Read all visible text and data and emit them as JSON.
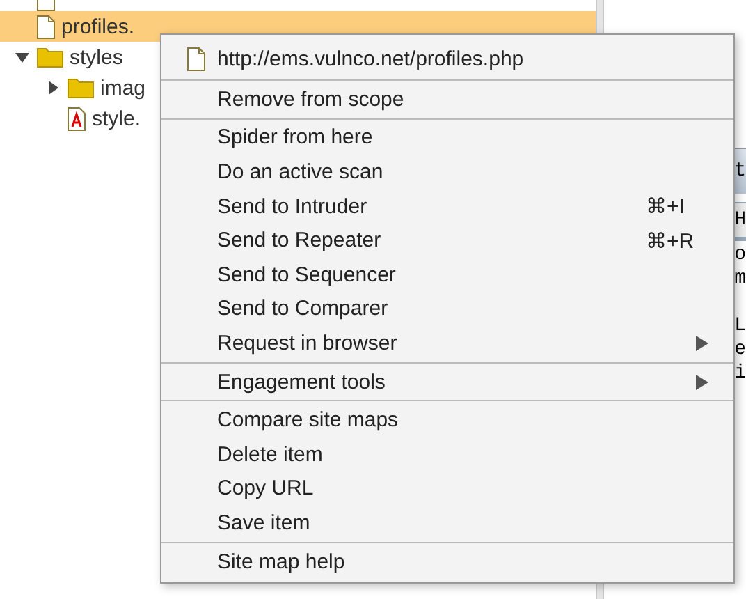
{
  "tree": [
    {
      "label": "profiles.",
      "kind": "file",
      "selected": true
    },
    {
      "label": "styles",
      "kind": "folder",
      "selected": false,
      "expanded": true,
      "children": [
        {
          "label": "imag",
          "kind": "folder",
          "selected": false,
          "expanded": false
        },
        {
          "label": "style.",
          "kind": "css",
          "selected": false
        }
      ]
    }
  ],
  "background_panel": {
    "tab": "t",
    "header": "H",
    "paragraphs": [
      [
        "o",
        "m"
      ],
      [
        "L",
        "e",
        "i"
      ]
    ]
  },
  "context_menu": {
    "sections": [
      [
        {
          "label": "http://ems.vulnco.net/profiles.php",
          "kind": "url"
        }
      ],
      [
        {
          "label": "Remove from scope",
          "kind": "item"
        }
      ],
      [
        {
          "label": "Spider from here",
          "kind": "item"
        },
        {
          "label": "Do an active scan",
          "kind": "item"
        },
        {
          "label": "Send to Intruder",
          "kind": "item",
          "shortcut": "⌘+I"
        },
        {
          "label": "Send to Repeater",
          "kind": "item",
          "shortcut": "⌘+R"
        },
        {
          "label": "Send to Sequencer",
          "kind": "item"
        },
        {
          "label": "Send to Comparer",
          "kind": "item"
        },
        {
          "label": "Request in browser",
          "kind": "submenu"
        }
      ],
      [
        {
          "label": "Engagement tools",
          "kind": "submenu"
        }
      ],
      [
        {
          "label": "Compare site maps",
          "kind": "item"
        },
        {
          "label": "Delete item",
          "kind": "item"
        },
        {
          "label": "Copy URL",
          "kind": "item"
        },
        {
          "label": "Save item",
          "kind": "item"
        }
      ],
      [
        {
          "label": "Site map help",
          "kind": "item"
        }
      ]
    ]
  }
}
